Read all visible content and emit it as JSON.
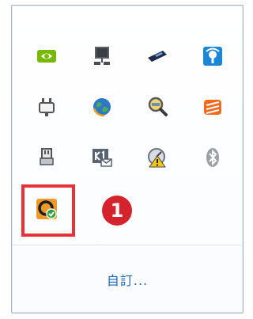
{
  "tray": {
    "icons": [
      {
        "name": "nvidia-icon"
      },
      {
        "name": "network-monitor-icon"
      },
      {
        "name": "card-reader-icon"
      },
      {
        "name": "wireless-signal-icon"
      },
      {
        "name": "power-plug-icon"
      },
      {
        "name": "globe-sync-icon"
      },
      {
        "name": "magnifier-icon"
      },
      {
        "name": "orange-app-icon"
      },
      {
        "name": "safely-remove-hardware-icon"
      },
      {
        "name": "k1-mail-icon"
      },
      {
        "name": "warning-gauge-icon"
      },
      {
        "name": "bluetooth-icon"
      },
      {
        "name": "highlighted-app-icon"
      }
    ]
  },
  "annotation": {
    "badge_number": "1",
    "highlight_color": "#e63339",
    "badge_color": "#d4232d"
  },
  "footer": {
    "customize_label": "自訂..."
  },
  "colors": {
    "link": "#1e64b4",
    "border": "#a7b4c4"
  }
}
